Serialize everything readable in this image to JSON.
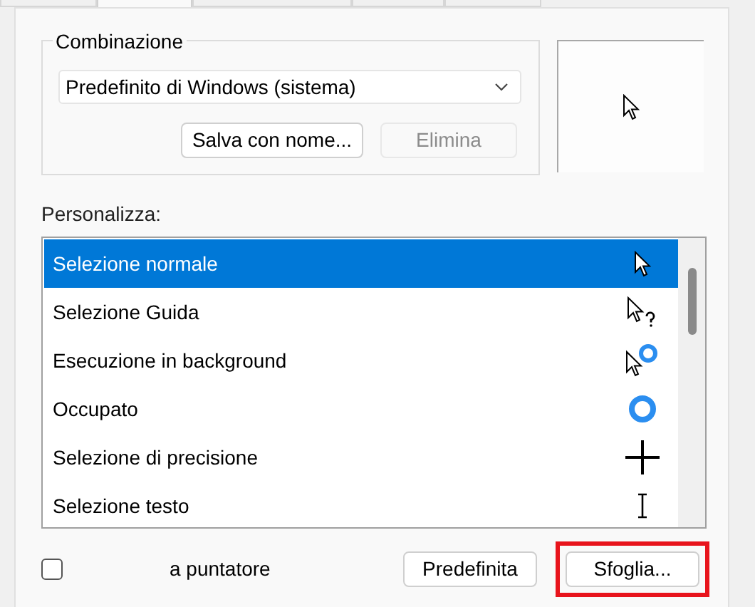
{
  "tabs": [
    {
      "selected": false
    },
    {
      "selected": true
    },
    {
      "selected": false
    },
    {
      "selected": false
    },
    {
      "selected": false
    }
  ],
  "scheme": {
    "label": "Combinazione",
    "value": "Predefinito di Windows (sistema)",
    "buttons": [
      {
        "label": "Salva con nome...",
        "disabled": false
      },
      {
        "label": "Elimina",
        "disabled": true
      }
    ]
  },
  "customize": {
    "label": "Personalizza:",
    "rows": [
      {
        "label": "Selezione normale",
        "selected": true
      },
      {
        "label": "Selezione Guida",
        "selected": false
      },
      {
        "label": "Esecuzione in background",
        "selected": false
      },
      {
        "label": "Occupato",
        "selected": false
      },
      {
        "label": "Selezione di precisione",
        "selected": false
      },
      {
        "label": "Selezione testo",
        "selected": false
      }
    ]
  },
  "shadow_checkbox": {
    "label": "a puntatore",
    "checked": false
  },
  "buttons": [
    {
      "label": "Predefinita",
      "highlighted": false
    },
    {
      "label": "Sfoglia...",
      "highlighted": true
    }
  ]
}
